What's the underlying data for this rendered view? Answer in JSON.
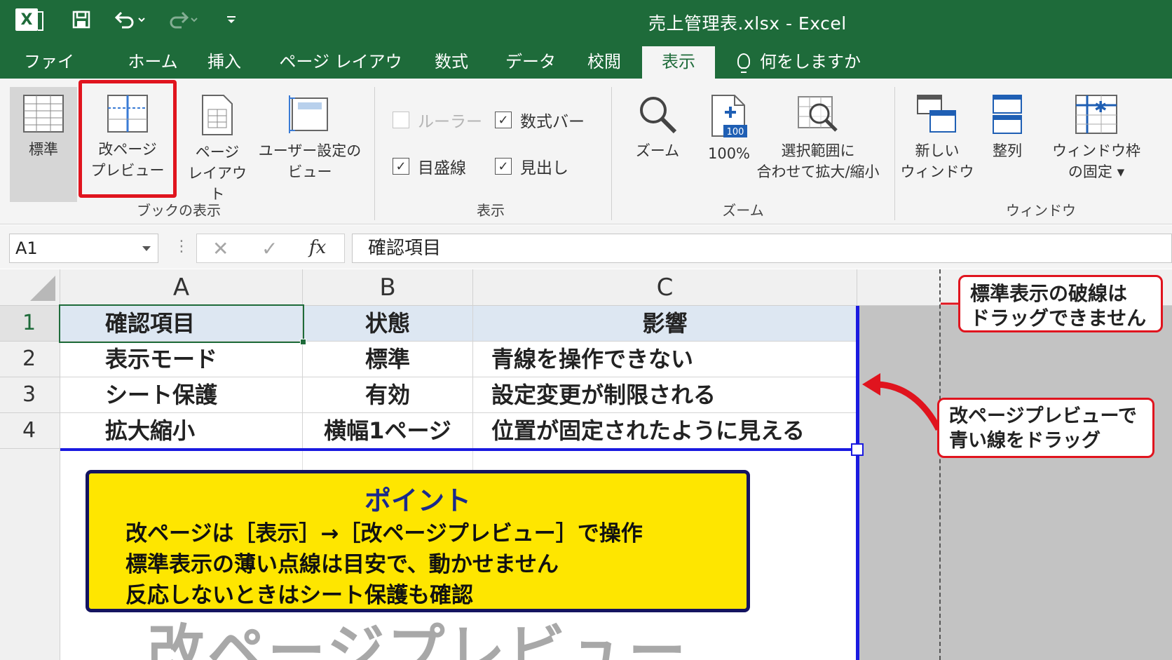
{
  "titlebar": {
    "title": "売上管理表.xlsx  -  Excel",
    "logo_letter": "X"
  },
  "tabs": [
    {
      "label": "ファイル"
    },
    {
      "label": "ホーム"
    },
    {
      "label": "挿入"
    },
    {
      "label": "ページ レイアウト"
    },
    {
      "label": "数式"
    },
    {
      "label": "データ"
    },
    {
      "label": "校閲"
    },
    {
      "label": "表示",
      "active": true
    },
    {
      "label": "何をしますか"
    }
  ],
  "ribbon": {
    "book_view": {
      "label": "ブックの表示",
      "normal": "標準",
      "page_break_preview": "改ページ\nプレビュー",
      "page_layout": "ページ\nレイアウト",
      "custom_views": "ユーザー設定の\nビュー"
    },
    "show": {
      "label": "表示",
      "ruler": "ルーラー",
      "formula_bar": "数式バー",
      "gridlines": "目盛線",
      "headings": "見出し"
    },
    "zoom": {
      "label": "ズーム",
      "zoom": "ズーム",
      "hundred": "100%",
      "hundred_badge": "100",
      "zoom_to_selection": "選択範囲に\n合わせて拡大/縮小"
    },
    "window": {
      "label": "ウィンドウ",
      "new_window": "新しい\nウィンドウ",
      "arrange": "整列",
      "freeze": "ウィンドウ枠\nの固定 ▾"
    }
  },
  "formula_bar": {
    "name_box": "A1",
    "fx": "fx",
    "content": "確認項目"
  },
  "sheet": {
    "columns": [
      "A",
      "B",
      "C"
    ],
    "rows": [
      "1",
      "2",
      "3",
      "4"
    ],
    "header": [
      "確認項目",
      "状態",
      "影響"
    ],
    "data": [
      [
        "表示モード",
        "標準",
        "青線を操作できない"
      ],
      [
        "シート保護",
        "有効",
        "設定変更が制限される"
      ],
      [
        "拡大縮小",
        "横幅1ページ",
        "位置が固定されたように見える"
      ]
    ],
    "watermark": "改ページプレビュー"
  },
  "callouts": {
    "dashed_note": "標準表示の破線は\nドラッグできません",
    "drag_note": "改ページプレビューで\n青い線をドラッグ"
  },
  "point": {
    "title": "ポイント",
    "lines": [
      "改ページは［表示］→［改ページプレビュー］で操作",
      "標準表示の薄い点線は目安で、動かせません",
      "反応しないときはシート保護も確認"
    ]
  },
  "colors": {
    "excel_green": "#1e6b3a",
    "page_break_blue": "#1a1ae0",
    "callout_red": "#e0141e",
    "point_yellow": "#fee600"
  }
}
